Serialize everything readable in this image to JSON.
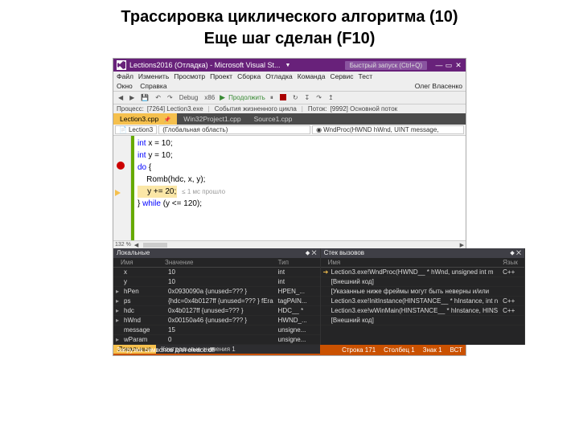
{
  "slide": {
    "title": "Трассировка циклического алгоритма (10)",
    "subtitle": "Еще шаг сделан (F10)"
  },
  "titlebar": {
    "app": "Lections2016 (Отладка) - Microsoft Visual St...",
    "quicklaunch": "Быстрый запуск (Ctrl+Q)"
  },
  "menu": {
    "items": [
      "Файл",
      "Изменить",
      "Просмотр",
      "Проект",
      "Сборка",
      "Отладка",
      "Команда",
      "Сервис",
      "Тест"
    ],
    "row2_left": [
      "Окно",
      "Справка"
    ],
    "user": "Олег Власенко"
  },
  "toolbar": {
    "debug": "Debug",
    "platform": "x86",
    "continue": "Продолжить"
  },
  "process": {
    "label": "Процесс:",
    "proc": "[7264] Lection3.exe",
    "events": "События жизненного цикла",
    "thread": "Поток:",
    "thr": "[9992] Основной поток"
  },
  "tabs": [
    "Lection3.cpp",
    "Win32Project1.cpp",
    "Source1.cpp"
  ],
  "nav": {
    "file": "Lection3",
    "scope": "(Глобальная область)",
    "func": "WndProc(HWND hWnd, UINT message,"
  },
  "code": {
    "l1a": "int",
    "l1b": " x = 10;",
    "l2a": "int",
    "l2b": " y = 10;",
    "l3a": "do",
    "l3b": " {",
    "l4": "    Romb(hdc, x, y);",
    "l5a": "    y += 20;",
    "l5tip": "≤ 1 мс прошло",
    "l6a": "} ",
    "l6b": "while",
    "l6c": " (y <= 120);"
  },
  "zoom": "132 %",
  "locals": {
    "title": "Локальные",
    "head": [
      "Имя",
      "Значение",
      "Тип"
    ],
    "rows": [
      {
        "ico": "",
        "n": "x",
        "v": "10",
        "t": "int"
      },
      {
        "ico": "",
        "n": "y",
        "v": "10",
        "t": "int"
      },
      {
        "ico": "▸",
        "n": "hPen",
        "v": "0x0930090a {unused=??? }",
        "t": "HPEN_..."
      },
      {
        "ico": "▸",
        "n": "ps",
        "v": "{hdc=0x4b0127ff {unused=??? } fEra",
        "t": "tagPAIN..."
      },
      {
        "ico": "▸",
        "n": "hdc",
        "v": "0x4b0127ff {unused=??? }",
        "t": "HDC__ *"
      },
      {
        "ico": "▸",
        "n": "hWnd",
        "v": "0x00150a46 {unused=??? }",
        "t": "HWND_..."
      },
      {
        "ico": "",
        "n": "message",
        "v": "15",
        "t": "unsigne..."
      },
      {
        "ico": "▸",
        "n": "wParam",
        "v": "0",
        "t": "unsigne..."
      }
    ],
    "tabs": [
      "Локальные",
      "Контрольные значения 1"
    ]
  },
  "callstack": {
    "title": "Стек вызовов",
    "head": [
      "Имя",
      "Язык"
    ],
    "rows": [
      {
        "ico": "➔",
        "n": "Lection3.exe!WndProc(HWND__ * hWnd, unsigned int m",
        "l": "C++"
      },
      {
        "ico": "",
        "n": "[Внешний код]",
        "l": ""
      },
      {
        "ico": "",
        "n": "[Указанные ниже фреймы могут быть неверны и/или",
        "l": ""
      },
      {
        "ico": "",
        "n": "Lection3.exe!InitInstance(HINSTANCE__ * hInstance, int n",
        "l": "C++"
      },
      {
        "ico": "",
        "n": "Lection3.exe!wWinMain(HINSTANCE__ * hInstance, HINS",
        "l": "C++"
      },
      {
        "ico": "",
        "n": "[Внешний код]",
        "l": ""
      }
    ]
  },
  "status": {
    "left": "Загрузка символов для oleacc.dll",
    "line": "Строка 171",
    "col": "Столбец 1",
    "ch": "Знак 1",
    "ins": "ВСТ"
  }
}
